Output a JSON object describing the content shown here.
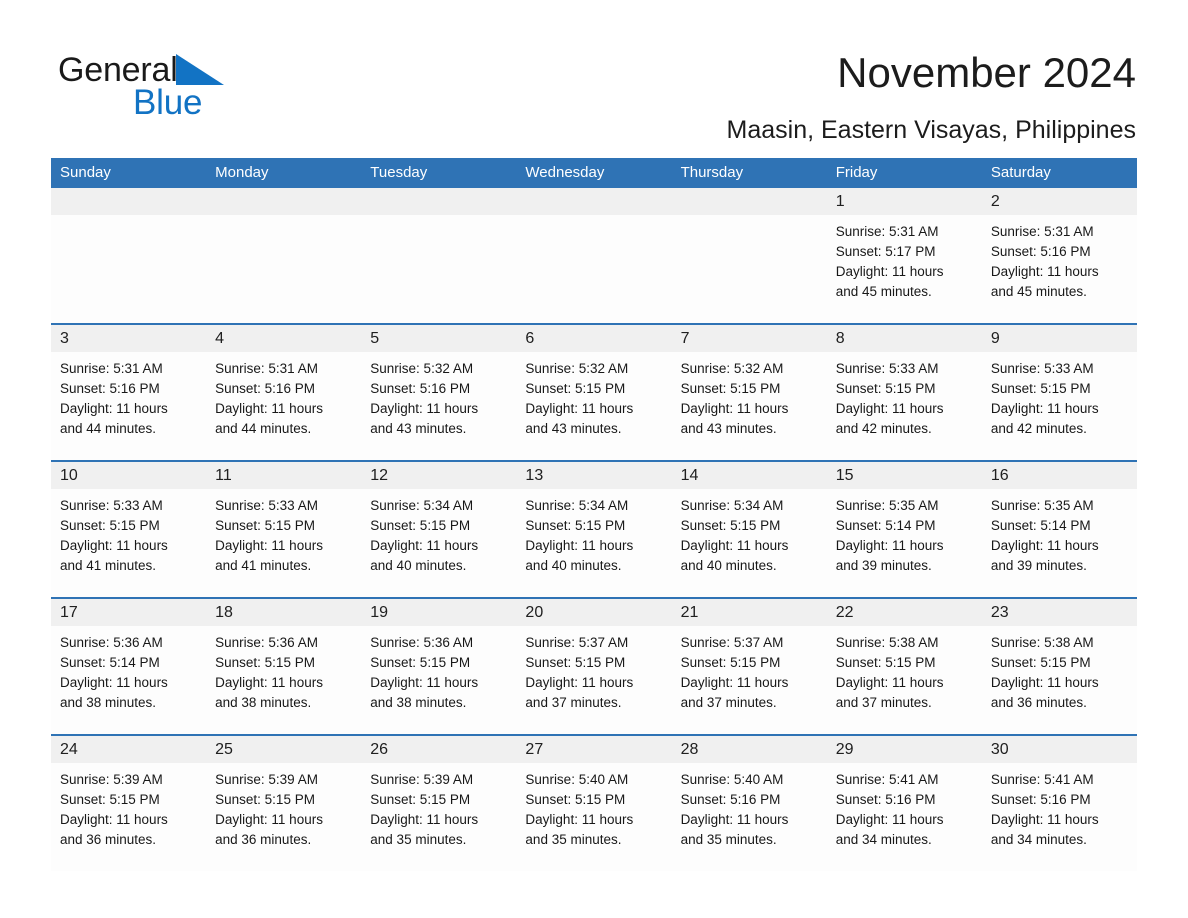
{
  "brand": {
    "name_part1": "General",
    "name_part2": "Blue",
    "logo_icon": "triangle-flag-icon",
    "blue_color": "#1273c4"
  },
  "header": {
    "month_title": "November 2024",
    "location": "Maasin, Eastern Visayas, Philippines"
  },
  "calendar": {
    "header_color": "#2f73b5",
    "day_band_color": "#f0f0f0",
    "weekdays": [
      "Sunday",
      "Monday",
      "Tuesday",
      "Wednesday",
      "Thursday",
      "Friday",
      "Saturday"
    ],
    "weeks": [
      [
        {
          "day": "",
          "empty": true
        },
        {
          "day": "",
          "empty": true
        },
        {
          "day": "",
          "empty": true
        },
        {
          "day": "",
          "empty": true
        },
        {
          "day": "",
          "empty": true
        },
        {
          "day": "1",
          "sunrise": "Sunrise: 5:31 AM",
          "sunset": "Sunset: 5:17 PM",
          "daylight1": "Daylight: 11 hours",
          "daylight2": "and 45 minutes."
        },
        {
          "day": "2",
          "sunrise": "Sunrise: 5:31 AM",
          "sunset": "Sunset: 5:16 PM",
          "daylight1": "Daylight: 11 hours",
          "daylight2": "and 45 minutes."
        }
      ],
      [
        {
          "day": "3",
          "sunrise": "Sunrise: 5:31 AM",
          "sunset": "Sunset: 5:16 PM",
          "daylight1": "Daylight: 11 hours",
          "daylight2": "and 44 minutes."
        },
        {
          "day": "4",
          "sunrise": "Sunrise: 5:31 AM",
          "sunset": "Sunset: 5:16 PM",
          "daylight1": "Daylight: 11 hours",
          "daylight2": "and 44 minutes."
        },
        {
          "day": "5",
          "sunrise": "Sunrise: 5:32 AM",
          "sunset": "Sunset: 5:16 PM",
          "daylight1": "Daylight: 11 hours",
          "daylight2": "and 43 minutes."
        },
        {
          "day": "6",
          "sunrise": "Sunrise: 5:32 AM",
          "sunset": "Sunset: 5:15 PM",
          "daylight1": "Daylight: 11 hours",
          "daylight2": "and 43 minutes."
        },
        {
          "day": "7",
          "sunrise": "Sunrise: 5:32 AM",
          "sunset": "Sunset: 5:15 PM",
          "daylight1": "Daylight: 11 hours",
          "daylight2": "and 43 minutes."
        },
        {
          "day": "8",
          "sunrise": "Sunrise: 5:33 AM",
          "sunset": "Sunset: 5:15 PM",
          "daylight1": "Daylight: 11 hours",
          "daylight2": "and 42 minutes."
        },
        {
          "day": "9",
          "sunrise": "Sunrise: 5:33 AM",
          "sunset": "Sunset: 5:15 PM",
          "daylight1": "Daylight: 11 hours",
          "daylight2": "and 42 minutes."
        }
      ],
      [
        {
          "day": "10",
          "sunrise": "Sunrise: 5:33 AM",
          "sunset": "Sunset: 5:15 PM",
          "daylight1": "Daylight: 11 hours",
          "daylight2": "and 41 minutes."
        },
        {
          "day": "11",
          "sunrise": "Sunrise: 5:33 AM",
          "sunset": "Sunset: 5:15 PM",
          "daylight1": "Daylight: 11 hours",
          "daylight2": "and 41 minutes."
        },
        {
          "day": "12",
          "sunrise": "Sunrise: 5:34 AM",
          "sunset": "Sunset: 5:15 PM",
          "daylight1": "Daylight: 11 hours",
          "daylight2": "and 40 minutes."
        },
        {
          "day": "13",
          "sunrise": "Sunrise: 5:34 AM",
          "sunset": "Sunset: 5:15 PM",
          "daylight1": "Daylight: 11 hours",
          "daylight2": "and 40 minutes."
        },
        {
          "day": "14",
          "sunrise": "Sunrise: 5:34 AM",
          "sunset": "Sunset: 5:15 PM",
          "daylight1": "Daylight: 11 hours",
          "daylight2": "and 40 minutes."
        },
        {
          "day": "15",
          "sunrise": "Sunrise: 5:35 AM",
          "sunset": "Sunset: 5:14 PM",
          "daylight1": "Daylight: 11 hours",
          "daylight2": "and 39 minutes."
        },
        {
          "day": "16",
          "sunrise": "Sunrise: 5:35 AM",
          "sunset": "Sunset: 5:14 PM",
          "daylight1": "Daylight: 11 hours",
          "daylight2": "and 39 minutes."
        }
      ],
      [
        {
          "day": "17",
          "sunrise": "Sunrise: 5:36 AM",
          "sunset": "Sunset: 5:14 PM",
          "daylight1": "Daylight: 11 hours",
          "daylight2": "and 38 minutes."
        },
        {
          "day": "18",
          "sunrise": "Sunrise: 5:36 AM",
          "sunset": "Sunset: 5:15 PM",
          "daylight1": "Daylight: 11 hours",
          "daylight2": "and 38 minutes."
        },
        {
          "day": "19",
          "sunrise": "Sunrise: 5:36 AM",
          "sunset": "Sunset: 5:15 PM",
          "daylight1": "Daylight: 11 hours",
          "daylight2": "and 38 minutes."
        },
        {
          "day": "20",
          "sunrise": "Sunrise: 5:37 AM",
          "sunset": "Sunset: 5:15 PM",
          "daylight1": "Daylight: 11 hours",
          "daylight2": "and 37 minutes."
        },
        {
          "day": "21",
          "sunrise": "Sunrise: 5:37 AM",
          "sunset": "Sunset: 5:15 PM",
          "daylight1": "Daylight: 11 hours",
          "daylight2": "and 37 minutes."
        },
        {
          "day": "22",
          "sunrise": "Sunrise: 5:38 AM",
          "sunset": "Sunset: 5:15 PM",
          "daylight1": "Daylight: 11 hours",
          "daylight2": "and 37 minutes."
        },
        {
          "day": "23",
          "sunrise": "Sunrise: 5:38 AM",
          "sunset": "Sunset: 5:15 PM",
          "daylight1": "Daylight: 11 hours",
          "daylight2": "and 36 minutes."
        }
      ],
      [
        {
          "day": "24",
          "sunrise": "Sunrise: 5:39 AM",
          "sunset": "Sunset: 5:15 PM",
          "daylight1": "Daylight: 11 hours",
          "daylight2": "and 36 minutes."
        },
        {
          "day": "25",
          "sunrise": "Sunrise: 5:39 AM",
          "sunset": "Sunset: 5:15 PM",
          "daylight1": "Daylight: 11 hours",
          "daylight2": "and 36 minutes."
        },
        {
          "day": "26",
          "sunrise": "Sunrise: 5:39 AM",
          "sunset": "Sunset: 5:15 PM",
          "daylight1": "Daylight: 11 hours",
          "daylight2": "and 35 minutes."
        },
        {
          "day": "27",
          "sunrise": "Sunrise: 5:40 AM",
          "sunset": "Sunset: 5:15 PM",
          "daylight1": "Daylight: 11 hours",
          "daylight2": "and 35 minutes."
        },
        {
          "day": "28",
          "sunrise": "Sunrise: 5:40 AM",
          "sunset": "Sunset: 5:16 PM",
          "daylight1": "Daylight: 11 hours",
          "daylight2": "and 35 minutes."
        },
        {
          "day": "29",
          "sunrise": "Sunrise: 5:41 AM",
          "sunset": "Sunset: 5:16 PM",
          "daylight1": "Daylight: 11 hours",
          "daylight2": "and 34 minutes."
        },
        {
          "day": "30",
          "sunrise": "Sunrise: 5:41 AM",
          "sunset": "Sunset: 5:16 PM",
          "daylight1": "Daylight: 11 hours",
          "daylight2": "and 34 minutes."
        }
      ]
    ]
  }
}
